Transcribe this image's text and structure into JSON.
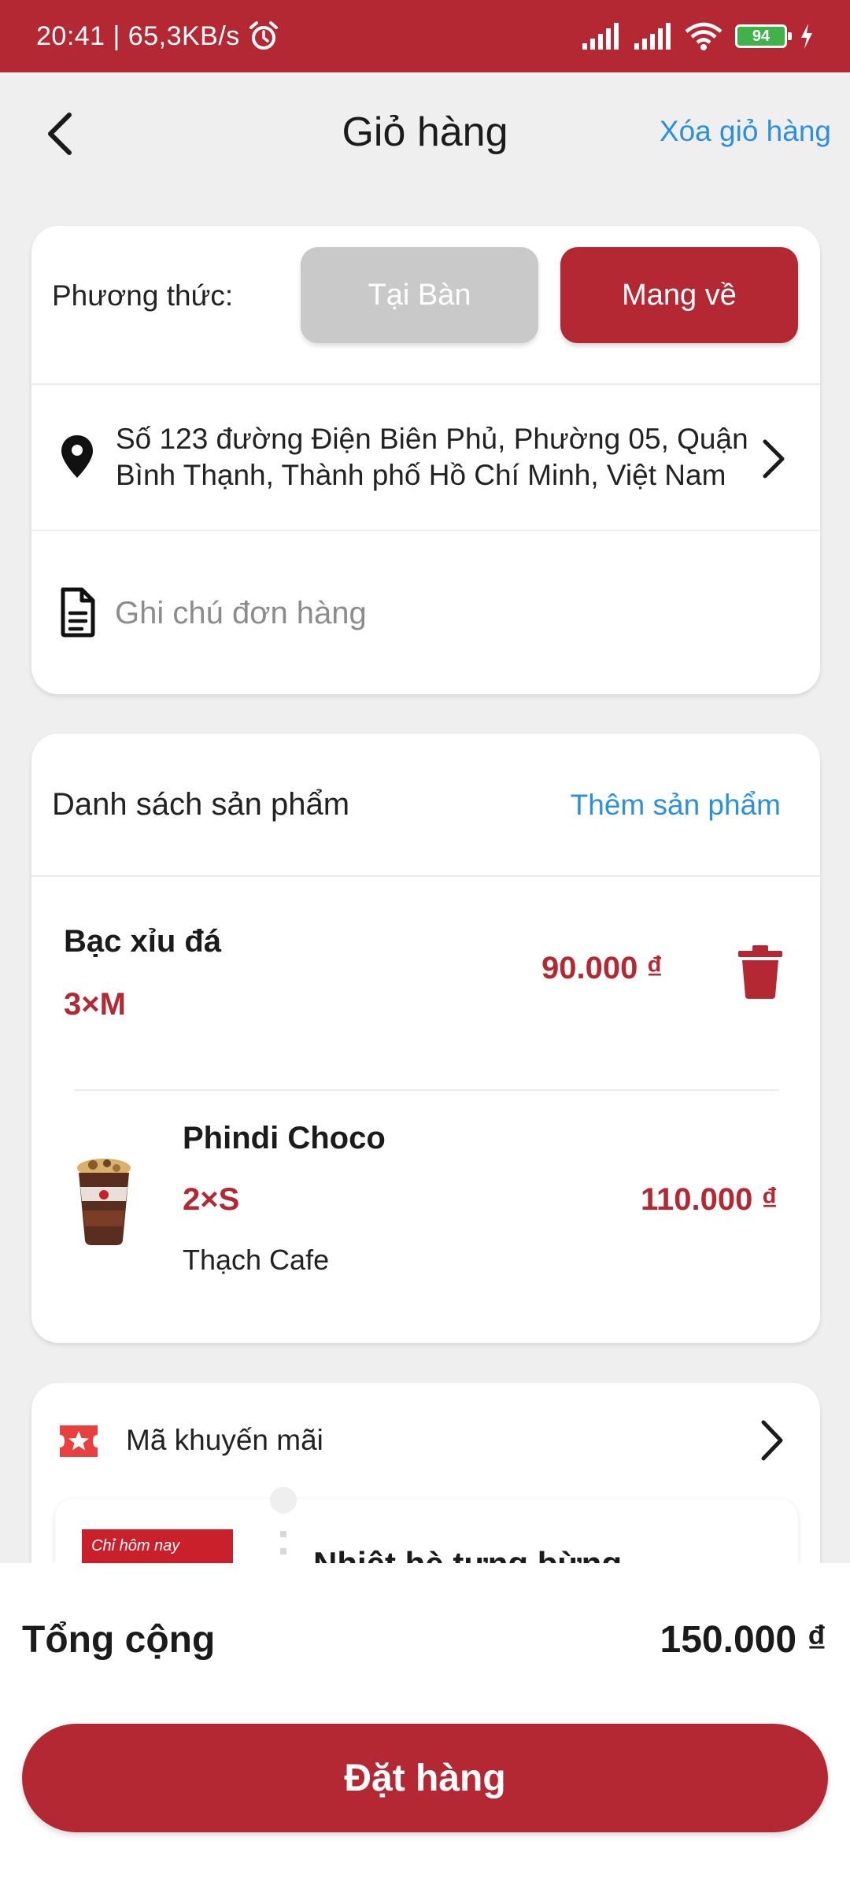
{
  "status_bar": {
    "time_speed": "20:41 | 65,3KB/s",
    "battery": "94"
  },
  "header": {
    "title": "Giỏ hàng",
    "clear_cart": "Xóa giỏ hàng"
  },
  "order_info": {
    "method_label": "Phương thức:",
    "method_options": [
      "Tại Bàn",
      "Mang về"
    ],
    "selected_method": "Mang về",
    "address": "Số 123 đường Điện Biên Phủ, Phường 05, Quận Bình Thạnh, Thành phố Hồ Chí Minh, Việt Nam",
    "note_placeholder": "Ghi chú đơn hàng",
    "note_value": ""
  },
  "products": {
    "title": "Danh sách sản phẩm",
    "add_label": "Thêm sản phẩm",
    "items": [
      {
        "name": "Bạc xỉu đá",
        "qty_size": "3×M",
        "price": "90.000 ₫"
      },
      {
        "name": "Phindi Choco",
        "qty_size": "2×S",
        "price": "110.000 ₫",
        "topping": "Thạch Cafe"
      }
    ]
  },
  "promo": {
    "label": "Mã khuyến mãi",
    "voucher_title": "Nhiệt hè tưng bừng",
    "voucher_image_text": "Chỉ hôm nay"
  },
  "footer": {
    "total_label": "Tổng cộng",
    "total_value": "150.000 ₫",
    "order_button": "Đặt hàng"
  },
  "colors": {
    "brand_red": "#b32832",
    "link_blue": "#2c8fe0",
    "disabled_gray": "#c9c9c9"
  }
}
